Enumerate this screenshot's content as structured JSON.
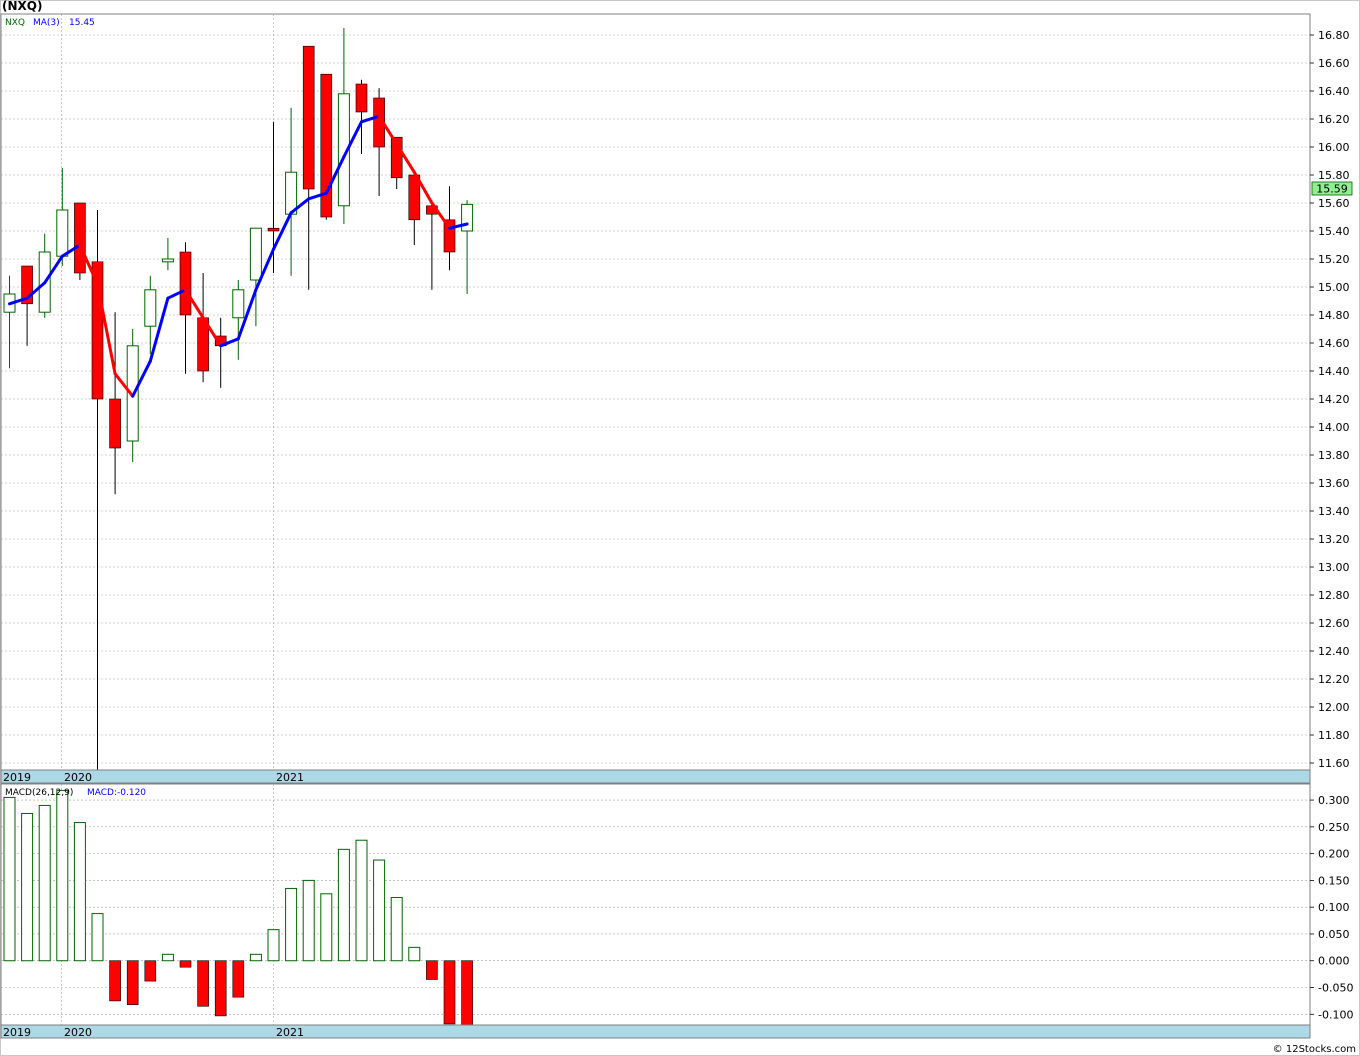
{
  "title": "(NXQ)",
  "price_legend": {
    "symbol": "NXQ",
    "ma_label": "MA(3)",
    "ma_value": "15.45"
  },
  "macd_legend": {
    "label": "MACD(26,12,9)",
    "value": "MACD:-0.120"
  },
  "last_price": "15.59",
  "footer": "© 12Stocks.com",
  "colors": {
    "up_candle_stroke": "#006400",
    "down_candle_fill": "#ff0000",
    "ma_up": "#0000ff",
    "ma_down": "#ff0000",
    "year_band": "#add8e6",
    "price_tag": "#90ee90",
    "grid": "#a0a0a0"
  },
  "chart_data": [
    {
      "type": "candlestick",
      "period": "monthly",
      "x_axis_labels": [
        "2019",
        "2020",
        "2021"
      ],
      "y_ticks": [
        "11.60",
        "11.80",
        "12.00",
        "12.20",
        "12.40",
        "12.60",
        "12.80",
        "13.00",
        "13.20",
        "13.40",
        "13.60",
        "13.80",
        "14.00",
        "14.20",
        "14.40",
        "14.60",
        "14.80",
        "15.00",
        "15.20",
        "15.40",
        "15.60",
        "15.80",
        "16.00",
        "16.20",
        "16.40",
        "16.60",
        "16.80"
      ],
      "ylim": [
        11.55,
        16.95
      ],
      "candles": [
        {
          "o": 14.82,
          "h": 15.08,
          "l": 14.42,
          "c": 14.95
        },
        {
          "o": 15.15,
          "h": 15.15,
          "l": 14.58,
          "c": 14.88
        },
        {
          "o": 14.82,
          "h": 15.38,
          "l": 14.78,
          "c": 15.25
        },
        {
          "o": 15.22,
          "h": 15.85,
          "l": 15.15,
          "c": 15.55
        },
        {
          "o": 15.6,
          "h": 15.6,
          "l": 15.05,
          "c": 15.1
        },
        {
          "o": 15.18,
          "h": 15.55,
          "l": 11.55,
          "c": 14.2
        },
        {
          "o": 14.2,
          "h": 14.82,
          "l": 13.52,
          "c": 13.85
        },
        {
          "o": 13.9,
          "h": 14.7,
          "l": 13.75,
          "c": 14.58
        },
        {
          "o": 14.72,
          "h": 15.08,
          "l": 14.52,
          "c": 14.98
        },
        {
          "o": 15.18,
          "h": 15.35,
          "l": 15.12,
          "c": 15.2
        },
        {
          "o": 15.25,
          "h": 15.32,
          "l": 14.38,
          "c": 14.8
        },
        {
          "o": 14.78,
          "h": 15.1,
          "l": 14.32,
          "c": 14.4
        },
        {
          "o": 14.65,
          "h": 14.78,
          "l": 14.28,
          "c": 14.58
        },
        {
          "o": 14.78,
          "h": 15.05,
          "l": 14.48,
          "c": 14.98
        },
        {
          "o": 15.05,
          "h": 15.42,
          "l": 14.72,
          "c": 15.42
        },
        {
          "o": 15.42,
          "h": 16.18,
          "l": 15.1,
          "c": 15.4
        },
        {
          "o": 15.52,
          "h": 16.28,
          "l": 15.08,
          "c": 15.82
        },
        {
          "o": 16.72,
          "h": 16.72,
          "l": 14.98,
          "c": 15.7
        },
        {
          "o": 16.52,
          "h": 16.52,
          "l": 15.48,
          "c": 15.5
        },
        {
          "o": 15.58,
          "h": 16.85,
          "l": 15.45,
          "c": 16.38
        },
        {
          "o": 16.45,
          "h": 16.48,
          "l": 15.95,
          "c": 16.25
        },
        {
          "o": 16.35,
          "h": 16.42,
          "l": 15.65,
          "c": 16.0
        },
        {
          "o": 16.07,
          "h": 16.07,
          "l": 15.7,
          "c": 15.78
        },
        {
          "o": 15.8,
          "h": 15.8,
          "l": 15.3,
          "c": 15.48
        },
        {
          "o": 15.58,
          "h": 15.62,
          "l": 14.98,
          "c": 15.52
        },
        {
          "o": 15.48,
          "h": 15.72,
          "l": 15.12,
          "c": 15.25
        },
        {
          "o": 15.4,
          "h": 15.62,
          "l": 14.95,
          "c": 15.59
        }
      ],
      "ma3": [
        14.88,
        14.92,
        15.03,
        15.22,
        15.3,
        15.02,
        14.38,
        14.22,
        14.47,
        14.92,
        14.98,
        14.78,
        14.58,
        14.63,
        14.98,
        15.27,
        15.53,
        15.63,
        15.67,
        15.93,
        16.18,
        16.22,
        16.02,
        15.82,
        15.6,
        15.42,
        15.45
      ]
    },
    {
      "type": "bar",
      "name": "MACD",
      "y_ticks": [
        "-0.100",
        "-0.050",
        "0.000",
        "0.050",
        "0.100",
        "0.150",
        "0.200",
        "0.250",
        "0.300"
      ],
      "ylim": [
        -0.12,
        0.33
      ],
      "values": [
        0.305,
        0.275,
        0.29,
        0.318,
        0.258,
        0.088,
        -0.075,
        -0.082,
        -0.038,
        0.012,
        -0.012,
        -0.085,
        -0.103,
        -0.068,
        0.012,
        0.058,
        0.135,
        0.15,
        0.125,
        0.208,
        0.225,
        0.188,
        0.118,
        0.025,
        -0.035,
        -0.118,
        -0.12
      ]
    }
  ]
}
